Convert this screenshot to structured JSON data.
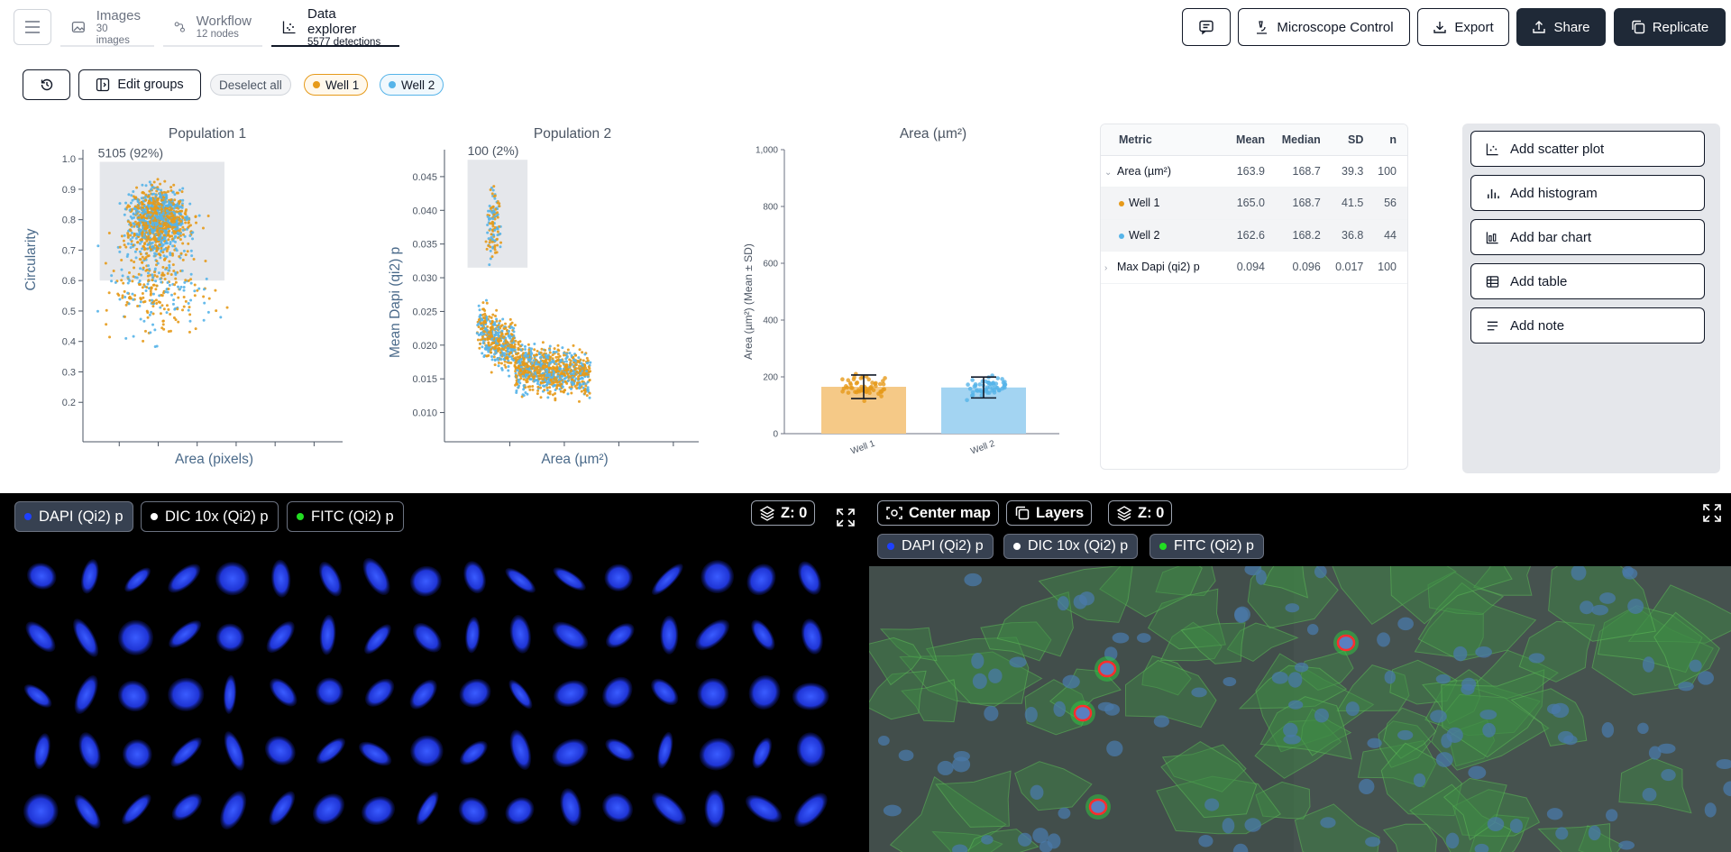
{
  "nav": {
    "tabs": [
      {
        "label": "Images",
        "sub": "30 images"
      },
      {
        "label": "Workflow",
        "sub": "12 nodes"
      },
      {
        "label": "Data explorer",
        "sub": "5577 detections"
      }
    ],
    "buttons": {
      "microscope": "Microscope Control",
      "export": "Export",
      "share": "Share",
      "replicate": "Replicate"
    }
  },
  "toolbar": {
    "edit_groups": "Edit groups",
    "deselect_all": "Deselect all",
    "groups": [
      {
        "label": "Well 1",
        "color": "#e69a1a"
      },
      {
        "label": "Well 2",
        "color": "#56b4e9"
      }
    ]
  },
  "colors": {
    "well1": "#e69a1a",
    "well2": "#56b4e9",
    "dark": "#1f2937"
  },
  "chart_data": [
    {
      "type": "scatter",
      "title": "Population 1",
      "xlabel": "Area (pixels)",
      "ylabel": "Circularity",
      "xlim": [
        300,
        6500
      ],
      "ylim": [
        0.1,
        1.03
      ],
      "xticks": [
        "1,000",
        "2,000",
        "3,000",
        "4,000",
        "5,000",
        "6,000"
      ],
      "yticks": [
        "0.2",
        "0.3",
        "0.4",
        "0.5",
        "0.6",
        "0.7",
        "0.8",
        "0.9",
        "1.0"
      ],
      "selection": {
        "label": "5105 (92%)",
        "x": [
          500,
          3700
        ],
        "y": [
          0.6,
          0.99
        ]
      },
      "series": [
        {
          "name": "Well 1"
        },
        {
          "name": "Well 2"
        }
      ]
    },
    {
      "type": "scatter",
      "title": "Population 2",
      "xlabel": "Area (µm²)",
      "ylabel": "Mean Dapi (qi2) p",
      "xlim": [
        0,
        860
      ],
      "ylim": [
        0.007,
        0.049
      ],
      "xticks": [
        "200",
        "400",
        "600",
        "800"
      ],
      "yticks": [
        "0.010",
        "0.015",
        "0.020",
        "0.025",
        "0.030",
        "0.035",
        "0.040",
        "0.045"
      ],
      "selection": {
        "label": "100 (2%)",
        "x": [
          45,
          265
        ],
        "y": [
          0.0315,
          0.0475
        ]
      },
      "series": [
        {
          "name": "Well 1"
        },
        {
          "name": "Well 2"
        }
      ]
    },
    {
      "type": "bar",
      "title": "Area (µm²)",
      "xlabel": "",
      "ylabel": "Area (µm²) (Mean ± SD)",
      "ylim": [
        0,
        1000
      ],
      "yticks": [
        "0",
        "200",
        "400",
        "600",
        "800",
        "1,000"
      ],
      "categories": [
        "Well 1",
        "Well 2"
      ],
      "values": [
        165.0,
        162.6
      ],
      "sd": [
        41.5,
        36.8
      ]
    }
  ],
  "stats": {
    "headers": [
      "Metric",
      "Mean",
      "Median",
      "SD",
      "n"
    ],
    "rows": [
      {
        "metric": "Area (µm²)",
        "mean": "163.9",
        "median": "168.7",
        "sd": "39.3",
        "n": "100"
      },
      {
        "metric": "Well 1",
        "mean": "165.0",
        "median": "168.7",
        "sd": "41.5",
        "n": "56"
      },
      {
        "metric": "Well 2",
        "mean": "162.6",
        "median": "168.2",
        "sd": "36.8",
        "n": "44"
      },
      {
        "metric": "Max Dapi (qi2) p",
        "mean": "0.094",
        "median": "0.096",
        "sd": "0.017",
        "n": "100"
      }
    ]
  },
  "add_panel": [
    "Add scatter plot",
    "Add histogram",
    "Add bar chart",
    "Add table",
    "Add note"
  ],
  "viewer": {
    "channels": [
      {
        "label": "DAPI (Qi2) p",
        "color": "#1e40ff"
      },
      {
        "label": "DIC 10x (Qi2) p",
        "color": "#ffffff"
      },
      {
        "label": "FITC (Qi2) p",
        "color": "#22dd22"
      }
    ],
    "z_label": "Z: 0",
    "center_map": "Center map",
    "layers": "Layers"
  }
}
